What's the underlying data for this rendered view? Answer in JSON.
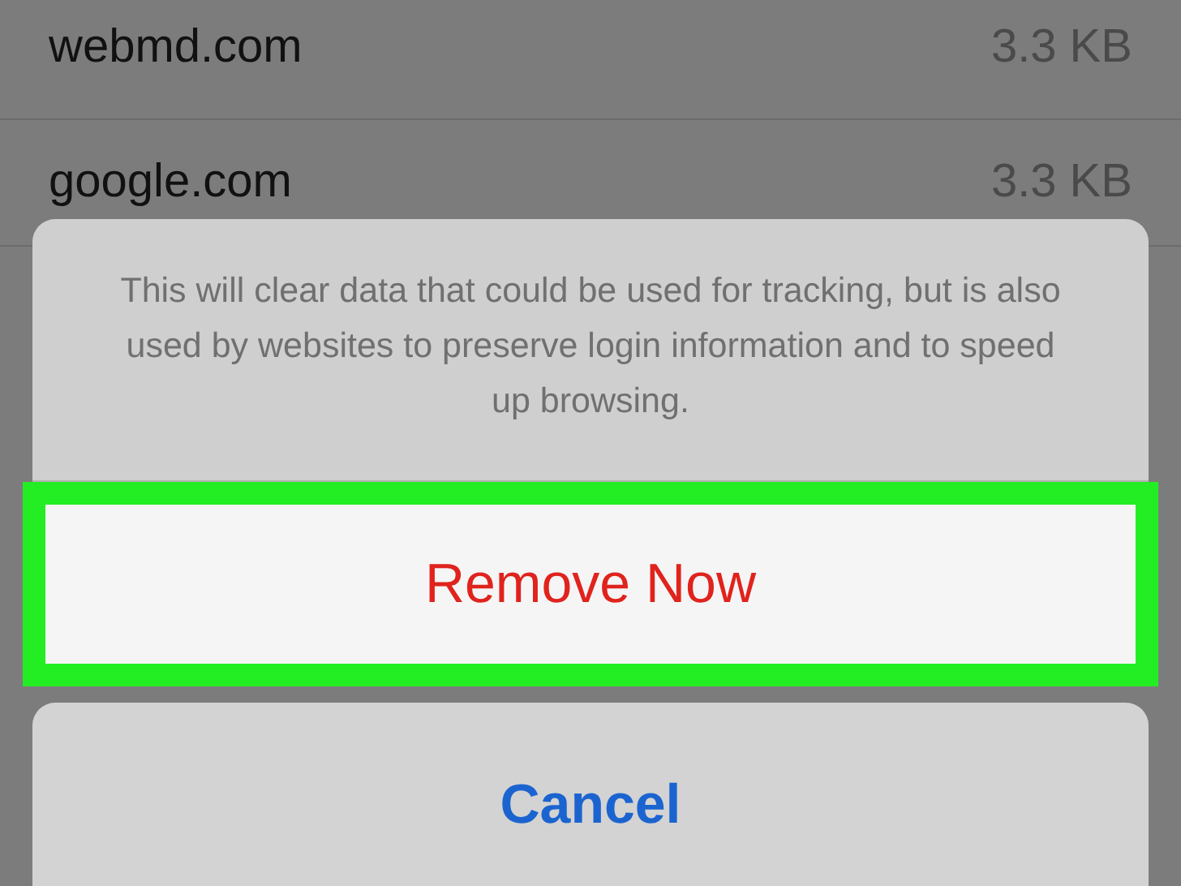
{
  "sites": [
    {
      "name": "webmd.com",
      "size": "3.3 KB"
    },
    {
      "name": "google.com",
      "size": "3.3 KB"
    }
  ],
  "action_sheet": {
    "message": "This will clear data that could be used for tracking, but is also used by websites to preserve login information and to speed up browsing.",
    "actions": [
      {
        "label": "Remove Now",
        "kind": "destructive",
        "highlighted": true
      }
    ],
    "cancel": {
      "label": "Cancel"
    }
  }
}
